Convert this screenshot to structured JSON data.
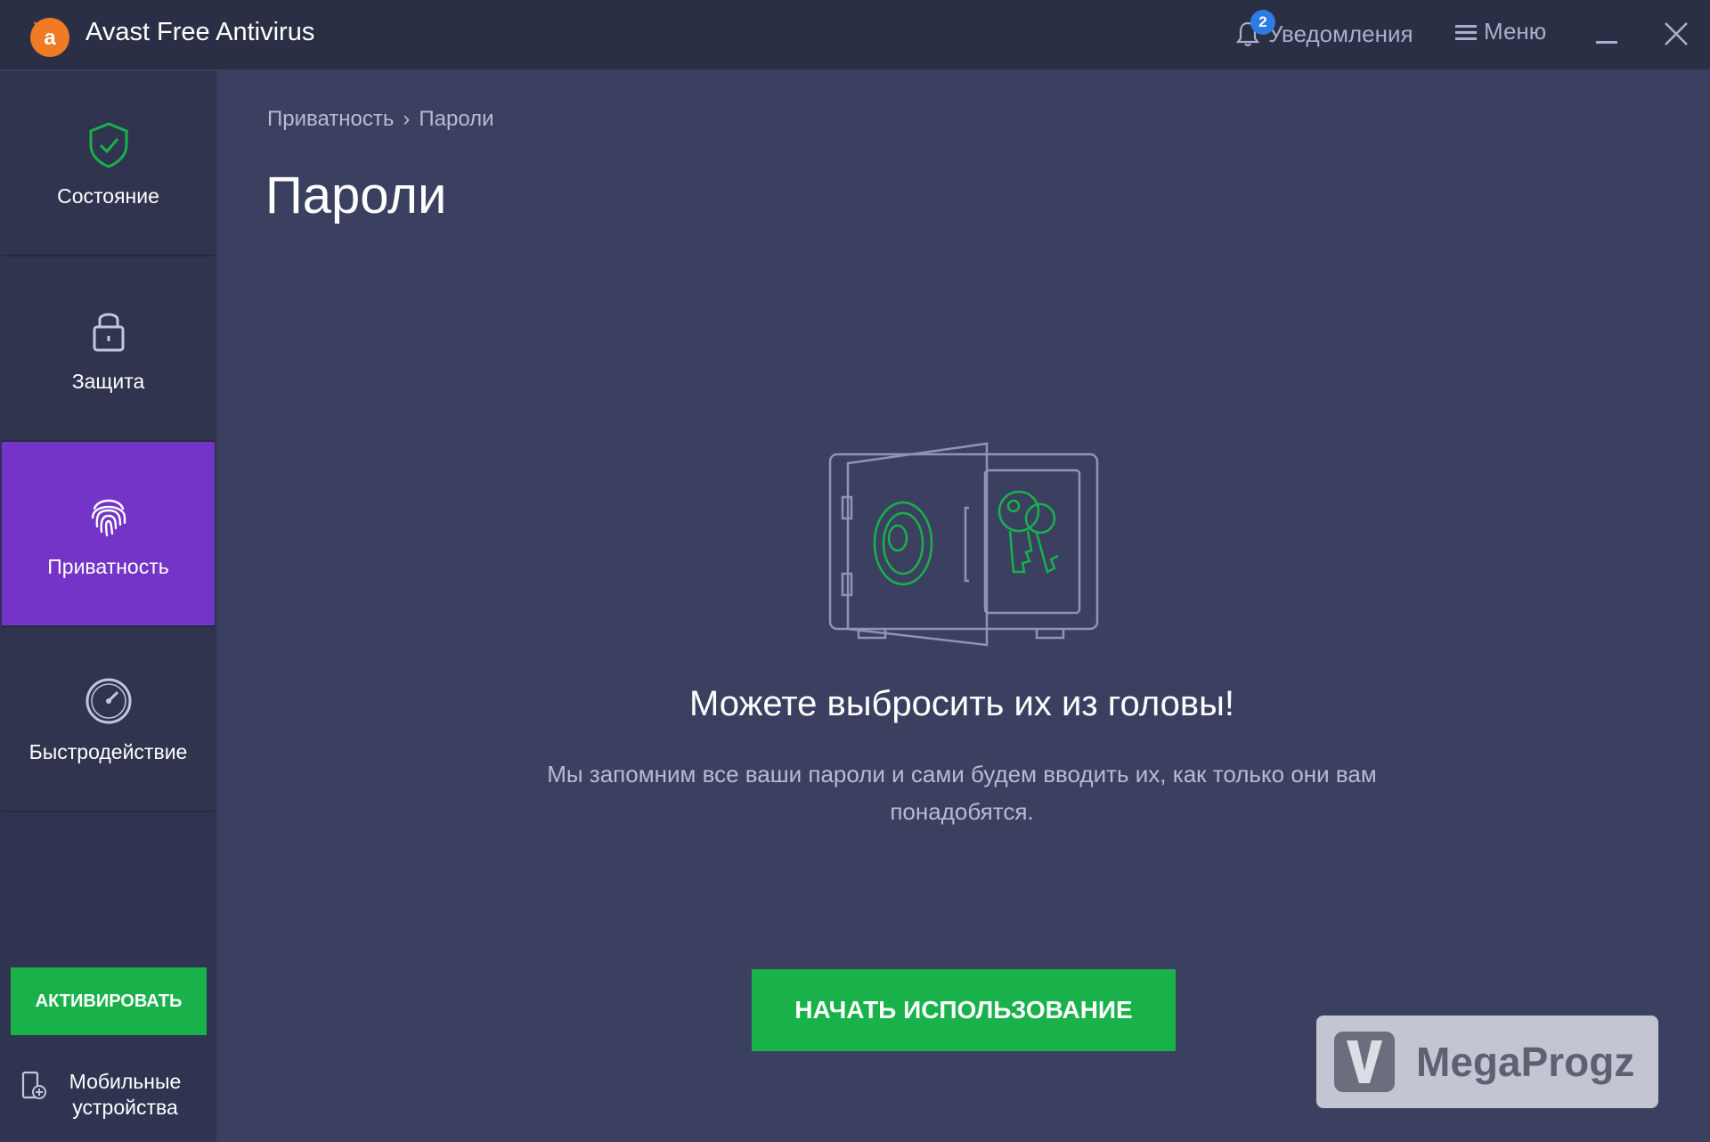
{
  "app": {
    "title": "Avast Free Antivirus",
    "notifications_label": "Уведомления",
    "notifications_count": "2",
    "menu_label": "Меню"
  },
  "sidebar": {
    "items": [
      {
        "label": "Состояние",
        "icon": "shield-check-icon"
      },
      {
        "label": "Защита",
        "icon": "lock-icon"
      },
      {
        "label": "Приватность",
        "icon": "fingerprint-icon",
        "active": true
      },
      {
        "label": "Быстродействие",
        "icon": "speedometer-icon"
      }
    ],
    "activate_label": "АКТИВИРОВАТЬ",
    "mobile_label": "Мобильные устройства"
  },
  "main": {
    "breadcrumb": [
      "Приватность",
      "Пароли"
    ],
    "title": "Пароли",
    "headline": "Можете выбросить их из головы!",
    "description": "Мы запомним все ваши пароли и сами будем вводить их, как только они вам понадобятся.",
    "start_label": "НАЧАТЬ ИСПОЛЬЗОВАНИЕ"
  },
  "watermark": {
    "text": "MegaProgz"
  },
  "colors": {
    "accent_green": "#18b14a",
    "active_purple": "#7434c7",
    "badge_blue": "#2d7be4",
    "logo_orange": "#f07b24"
  }
}
